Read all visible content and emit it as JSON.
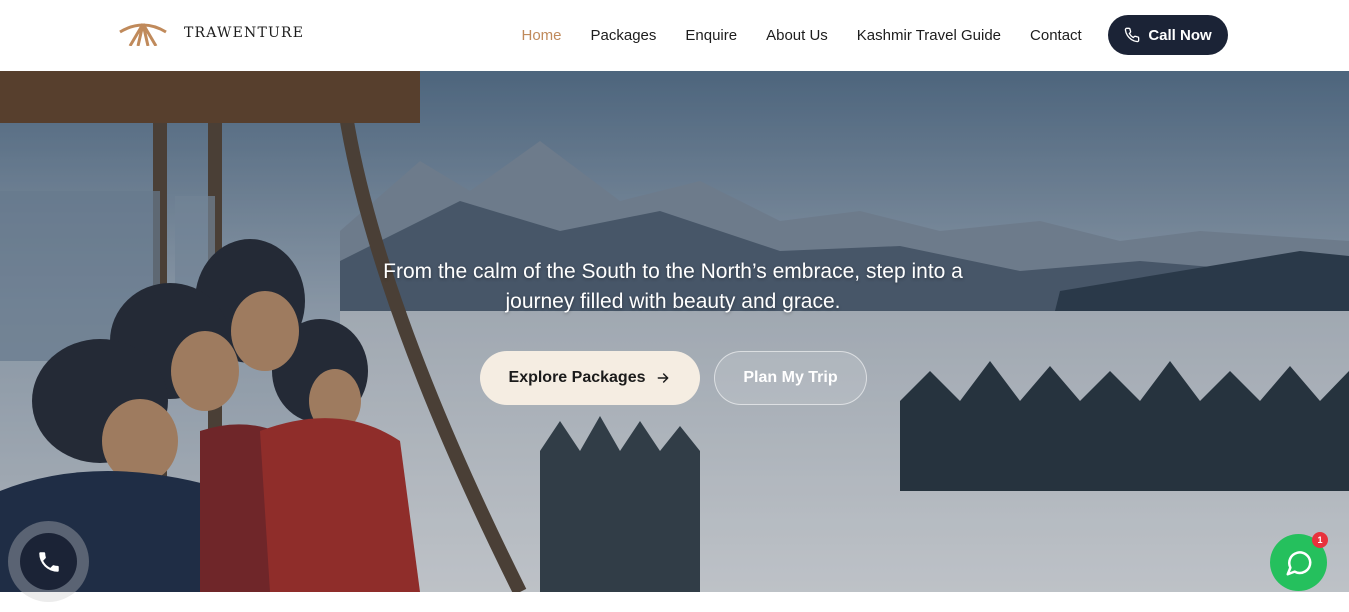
{
  "header": {
    "brand": "TRAWENTURE",
    "nav": [
      {
        "label": "Home",
        "active": true
      },
      {
        "label": "Packages",
        "active": false
      },
      {
        "label": "Enquire",
        "active": false
      },
      {
        "label": "About Us",
        "active": false
      },
      {
        "label": "Kashmir Travel Guide",
        "active": false
      },
      {
        "label": "Contact",
        "active": false
      }
    ],
    "call_label": "Call Now",
    "accent_color": "#c08a5b",
    "dark_color": "#1b2336"
  },
  "hero": {
    "tagline": "From the calm of the South to the North’s embrace, step into a journey filled with beauty and grace.",
    "primary_button": "Explore Packages",
    "primary_icon": "arrow-right-icon",
    "secondary_button": "Plan My Trip",
    "background": "cable-car-family-snowy-valley-photo"
  },
  "floating": {
    "call_icon": "phone-icon",
    "whatsapp_icon": "whatsapp-chat-icon",
    "whatsapp_badge": "1",
    "whatsapp_color": "#25c05d",
    "badge_color": "#e8323c"
  }
}
